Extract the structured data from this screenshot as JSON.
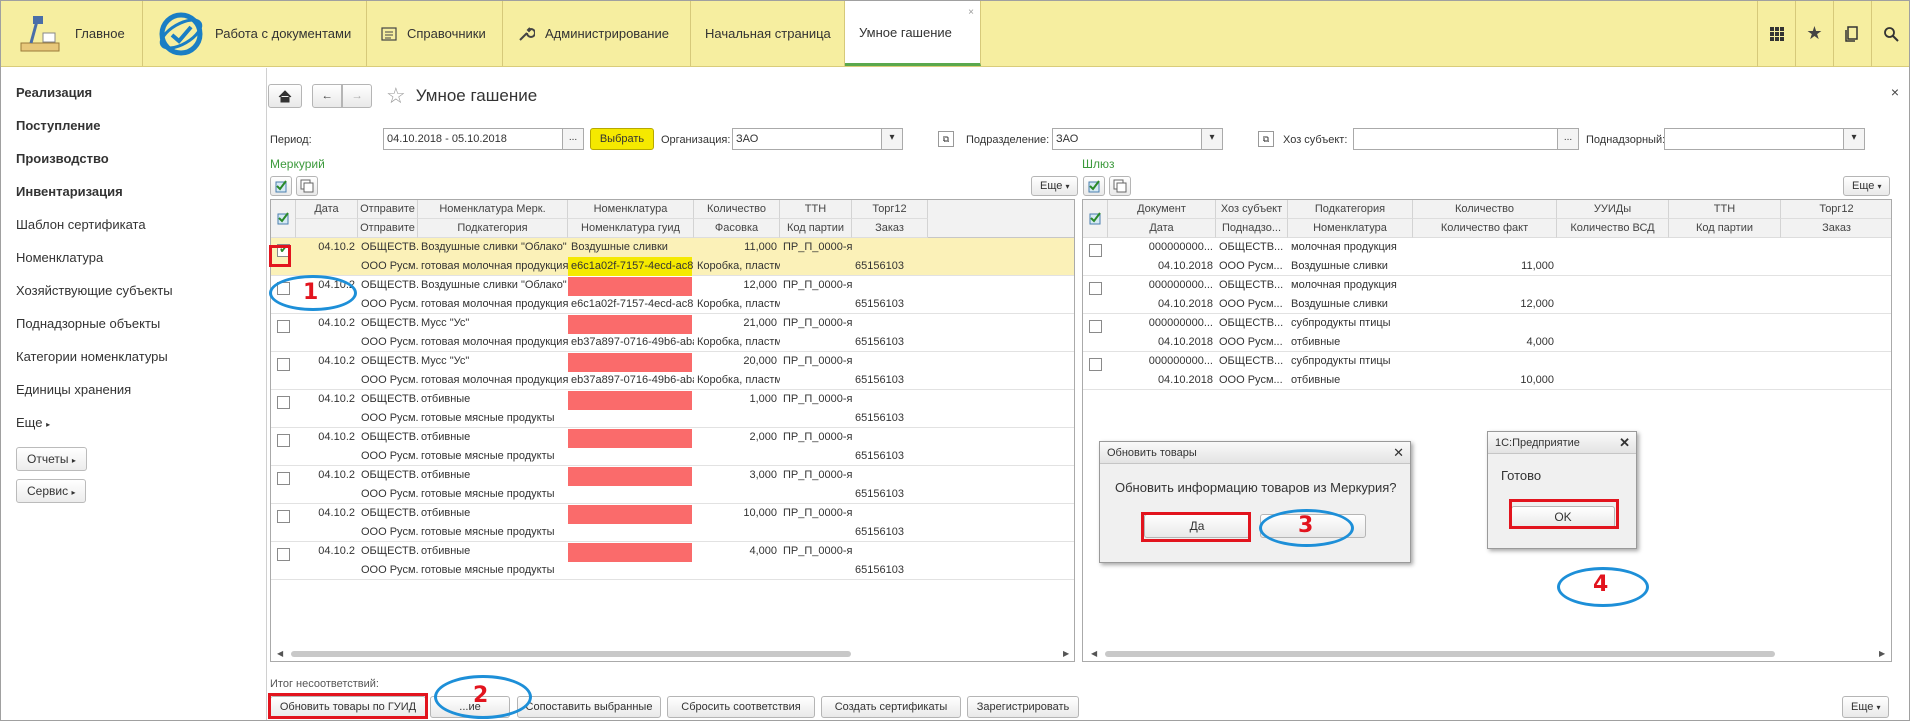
{
  "topbar": {
    "home": "Главное",
    "docs": "Работа с документами",
    "refs": "Справочники",
    "admin": "Администрирование",
    "tab_start": "Начальная страница",
    "tab_active": "Умное гашение",
    "tab_close": "×"
  },
  "sidebar": {
    "bold": [
      "Реализация",
      "Поступление",
      "Производство",
      "Инвентаризация"
    ],
    "items": [
      "Шаблон сертификата",
      "Номенклатура",
      "Хозяйствующие субъекты",
      "Поднадзорные объекты",
      "Категории номенклатуры",
      "Единицы хранения"
    ],
    "more": "Еще",
    "reports": "Отчеты",
    "service": "Сервис"
  },
  "page": {
    "title": "Умное гашение",
    "close": "×"
  },
  "filters": {
    "period_label": "Период:",
    "period_value": "04.10.2018 - 05.10.2018",
    "ellipsis": "...",
    "select_btn": "Выбрать",
    "org_label": "Организация:",
    "org_value": "ЗАО",
    "dept_label": "Подразделение:",
    "dept_value": "ЗАО",
    "subj_label": "Хоз субъект:",
    "subj_value": "",
    "supervised_label": "Поднадзорный:",
    "supervised_value": ""
  },
  "left": {
    "section": "Меркурий",
    "more": "Еще",
    "headers_top": [
      "Дата",
      "Отправите",
      "Номенклатура Мерк.",
      "Номенклатура",
      "Количество",
      "ТТН",
      "Торг12"
    ],
    "headers_bottom": [
      "",
      "Отправите",
      "Подкатегория",
      "Номенклатура гуид",
      "Фасовка",
      "Код партии",
      "Заказ"
    ],
    "rows": [
      {
        "checked": true,
        "date": "04.10.2",
        "sender1": "ОБЩЕСТВ...",
        "nom_merc": "Воздушные сливки \"Облако\"",
        "nom": "Воздушные сливки",
        "qty": "11,000",
        "ttn": "ПР_П_0000-я...",
        "torg": "",
        "sender2": "ООО Русм...",
        "subcat": "готовая молочная продукция",
        "guid": "e6c1a02f-7157-4ecd-ac81-...",
        "pack": "Коробка, пластм...",
        "lot": "",
        "order": "65156103"
      },
      {
        "checked": false,
        "date": "04.10.2",
        "sender1": "ОБЩЕСТВ...",
        "nom_merc": "Воздушные сливки \"Облако\"",
        "nom": "",
        "qty": "12,000",
        "ttn": "ПР_П_0000-я...",
        "torg": "",
        "sender2": "ООО Русм...",
        "subcat": "готовая молочная продукция",
        "guid": "e6c1a02f-7157-4ecd-ac81-...",
        "pack": "Коробка, пластм...",
        "lot": "",
        "order": "65156103"
      },
      {
        "checked": false,
        "date": "04.10.2",
        "sender1": "ОБЩЕСТВ...",
        "nom_merc": "Мусс \"Ус\"",
        "nom": "",
        "qty": "21,000",
        "ttn": "ПР_П_0000-я...",
        "torg": "",
        "sender2": "ООО Русм...",
        "subcat": "готовая молочная продукция",
        "guid": "eb37a897-0716-49b6-aba8-...",
        "pack": "Коробка, пластм...",
        "lot": "",
        "order": "65156103"
      },
      {
        "checked": false,
        "date": "04.10.2",
        "sender1": "ОБЩЕСТВ...",
        "nom_merc": "Мусс \"Ус\"",
        "nom": "",
        "qty": "20,000",
        "ttn": "ПР_П_0000-я...",
        "torg": "",
        "sender2": "ООО Русм...",
        "subcat": "готовая молочная продукция",
        "guid": "eb37a897-0716-49b6-aba8-...",
        "pack": "Коробка, пластм...",
        "lot": "",
        "order": "65156103"
      },
      {
        "checked": false,
        "date": "04.10.2",
        "sender1": "ОБЩЕСТВ...",
        "nom_merc": "отбивные",
        "nom": "",
        "qty": "1,000",
        "ttn": "ПР_П_0000-я...",
        "torg": "",
        "sender2": "ООО Русм...",
        "subcat": "готовые мясные продукты",
        "guid": "",
        "pack": "",
        "lot": "",
        "order": "65156103"
      },
      {
        "checked": false,
        "date": "04.10.2",
        "sender1": "ОБЩЕСТВ...",
        "nom_merc": "отбивные",
        "nom": "",
        "qty": "2,000",
        "ttn": "ПР_П_0000-я...",
        "torg": "",
        "sender2": "ООО Русм...",
        "subcat": "готовые мясные продукты",
        "guid": "",
        "pack": "",
        "lot": "",
        "order": "65156103"
      },
      {
        "checked": false,
        "date": "04.10.2",
        "sender1": "ОБЩЕСТВ...",
        "nom_merc": "отбивные",
        "nom": "",
        "qty": "3,000",
        "ttn": "ПР_П_0000-я...",
        "torg": "",
        "sender2": "ООО Русм...",
        "subcat": "готовые мясные продукты",
        "guid": "",
        "pack": "",
        "lot": "",
        "order": "65156103"
      },
      {
        "checked": false,
        "date": "04.10.2",
        "sender1": "ОБЩЕСТВ...",
        "nom_merc": "отбивные",
        "nom": "",
        "qty": "10,000",
        "ttn": "ПР_П_0000-я...",
        "torg": "",
        "sender2": "ООО Русм...",
        "subcat": "готовые мясные продукты",
        "guid": "",
        "pack": "",
        "lot": "",
        "order": "65156103"
      },
      {
        "checked": false,
        "date": "04.10.2",
        "sender1": "ОБЩЕСТВ...",
        "nom_merc": "отбивные",
        "nom": "",
        "qty": "4,000",
        "ttn": "ПР_П_0000-я...",
        "torg": "",
        "sender2": "ООО Русм...",
        "subcat": "готовые мясные продукты",
        "guid": "",
        "pack": "",
        "lot": "",
        "order": "65156103"
      }
    ]
  },
  "right": {
    "section": "Шлюз",
    "more": "Еще",
    "headers_top": [
      "Документ",
      "Хоз субъект",
      "Подкатегория",
      "Количество",
      "УУИДы",
      "ТТН",
      "Торг12"
    ],
    "headers_bottom": [
      "Дата",
      "Поднадзо...",
      "Номенклатура",
      "Количество факт",
      "Количество ВСД",
      "Код партии",
      "Заказ"
    ],
    "rows": [
      {
        "doc": "000000000...",
        "subj": "ОБЩЕСТВ...",
        "subcat": "молочная продукция",
        "date": "04.10.2018",
        "sup": "ООО Русм...",
        "nom": "Воздушные сливки",
        "qty_fact": "11,000"
      },
      {
        "doc": "000000000...",
        "subj": "ОБЩЕСТВ...",
        "subcat": "молочная продукция",
        "date": "04.10.2018",
        "sup": "ООО Русм...",
        "nom": "Воздушные сливки",
        "qty_fact": "12,000"
      },
      {
        "doc": "000000000...",
        "subj": "ОБЩЕСТВ...",
        "subcat": "субпродукты птицы",
        "date": "04.10.2018",
        "sup": "ООО Русм...",
        "nom": "отбивные",
        "qty_fact": "4,000"
      },
      {
        "doc": "000000000...",
        "subj": "ОБЩЕСТВ...",
        "subcat": "субпродукты птицы",
        "date": "04.10.2018",
        "sup": "ООО Русм...",
        "nom": "отбивные",
        "qty_fact": "10,000"
      }
    ]
  },
  "bottom": {
    "label": "Итог несоответствий:",
    "buttons": [
      "Обновить товары по ГУИД",
      "...ие",
      "Сопоставить выбранные",
      "Сбросить соответствия",
      "Создать сертификаты",
      "Зарегистрировать"
    ],
    "more": "Еще"
  },
  "dialog_update": {
    "title": "Обновить товары",
    "text": "Обновить информацию товаров из Меркурия?",
    "yes": "Да",
    "no": "",
    "close": "✕"
  },
  "dialog_done": {
    "title": "1С:Предприятие",
    "text": "Готово",
    "ok": "OK",
    "close": "✕"
  },
  "annotations": [
    "1",
    "2",
    "3",
    "4"
  ],
  "colors": {
    "topbar": "#f6eea0",
    "accent": "#5aa84c",
    "highlight": "#f5e900",
    "redact": "#fa6b6b",
    "frame": "#e2141e",
    "ellipse": "#1d8fd8"
  }
}
